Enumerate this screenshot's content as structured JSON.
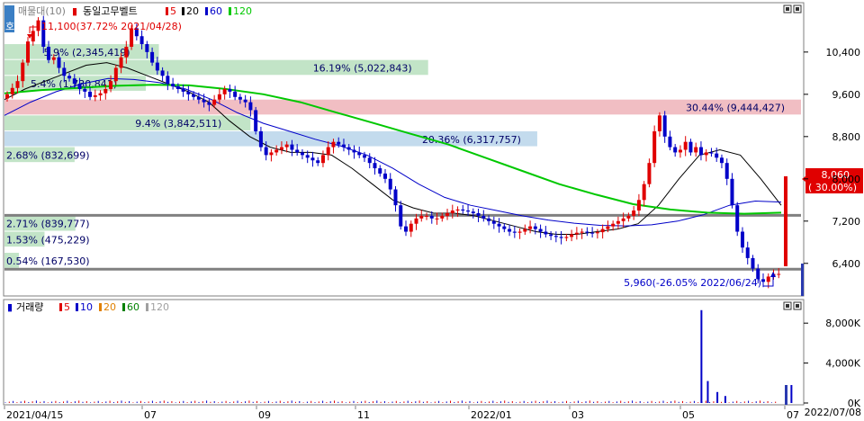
{
  "price_pane": {
    "legend": {
      "marker_label": "호",
      "indicator": "매물대(10)",
      "stock_name": "동일고무벨트",
      "ma_items": [
        {
          "label": "5",
          "color": "#e00000"
        },
        {
          "label": "20",
          "color": "#000000"
        },
        {
          "label": "60",
          "color": "#0000c8"
        },
        {
          "label": "120",
          "color": "#00c800"
        }
      ]
    },
    "y_ticks": [
      "10,400",
      "9,600",
      "8,800",
      "8,000",
      "7,200",
      "6,400"
    ],
    "high_annotation": "11,100(37.72% 2021/04/28)",
    "low_annotation": "5,960(-26.05% 2022/06/24)",
    "current_price": "8,060",
    "current_change": "( 30.00%)"
  },
  "volume_pane": {
    "legend": {
      "title": "거래량",
      "ma_items": [
        {
          "label": "5",
          "color": "#e00000"
        },
        {
          "label": "10",
          "color": "#0000c8"
        },
        {
          "label": "20",
          "color": "#e08000"
        },
        {
          "label": "60",
          "color": "#008000"
        },
        {
          "label": "120",
          "color": "#a0a0a0"
        }
      ]
    },
    "y_ticks": [
      "8,000K",
      "4,000K",
      "0K"
    ]
  },
  "x_axis": {
    "ticks": [
      "2021/04/15",
      "07",
      "09",
      "11",
      "2022/01",
      "03",
      "05",
      "07"
    ],
    "end_date": "2022/07/08"
  },
  "chart_data": {
    "type": "candlestick",
    "ylim": [
      5800,
      11300
    ],
    "volume_ylim": [
      0,
      10000
    ],
    "volume_unit": "K",
    "volume_profile": [
      {
        "price_low": 10250,
        "price_high": 10550,
        "percent": 5.9,
        "volume": 2345419,
        "label": "5.9% (2,345,419)"
      },
      {
        "price_low": 9950,
        "price_high": 10250,
        "percent": 16.19,
        "volume": 5022843,
        "label": "16.19% (5,022,843)"
      },
      {
        "price_low": 9650,
        "price_high": 9950,
        "percent": 5.4,
        "volume": 1730841,
        "label": "5.4% (1,730,841)"
      },
      {
        "price_low": 9200,
        "price_high": 9500,
        "percent": 30.44,
        "volume": 9444427,
        "label": "30.44% (9,444,427)"
      },
      {
        "price_low": 8900,
        "price_high": 9200,
        "percent": 9.4,
        "volume": 3842511,
        "label": "9.4% (3,842,511)"
      },
      {
        "price_low": 8600,
        "price_high": 8900,
        "percent": 20.36,
        "volume": 6317757,
        "label": "20.36% (6,317,757)"
      },
      {
        "price_low": 8300,
        "price_high": 8600,
        "percent": 2.68,
        "volume": 832699,
        "label": "2.68% (832,699)"
      },
      {
        "price_low": 7000,
        "price_high": 7300,
        "percent": 2.71,
        "volume": 839777,
        "label": "2.71% (839,777)"
      },
      {
        "price_low": 6700,
        "price_high": 7000,
        "percent": 1.53,
        "volume": 475229,
        "label": "1.53% (475,229)"
      },
      {
        "price_low": 6300,
        "price_high": 6600,
        "percent": 0.54,
        "volume": 167530,
        "label": "0.54% (167,530)"
      }
    ],
    "horizontal_lines": [
      7310,
      6290
    ],
    "closes": [
      9600,
      9720,
      9850,
      10200,
      10600,
      10800,
      11000,
      10500,
      10250,
      10300,
      10100,
      9950,
      9900,
      9800,
      9700,
      9650,
      9550,
      9580,
      9620,
      9700,
      9850,
      10100,
      10300,
      10500,
      10850,
      10700,
      10550,
      10400,
      10200,
      10050,
      9950,
      9800,
      9750,
      9700,
      9650,
      9600,
      9550,
      9500,
      9450,
      9400,
      9500,
      9600,
      9700,
      9650,
      9550,
      9500,
      9450,
      9300,
      8900,
      8600,
      8450,
      8500,
      8550,
      8600,
      8650,
      8550,
      8500,
      8450,
      8400,
      8350,
      8300,
      8450,
      8600,
      8700,
      8650,
      8600,
      8550,
      8500,
      8450,
      8400,
      8300,
      8200,
      8100,
      8000,
      7800,
      7500,
      7100,
      7000,
      7150,
      7250,
      7300,
      7300,
      7250,
      7250,
      7300,
      7350,
      7400,
      7420,
      7400,
      7380,
      7350,
      7300,
      7250,
      7200,
      7150,
      7100,
      7050,
      7000,
      6980,
      7000,
      7050,
      7100,
      7050,
      7000,
      6950,
      6920,
      6900,
      6880,
      6900,
      6950,
      6980,
      7000,
      6980,
      6970,
      6990,
      7050,
      7100,
      7150,
      7200,
      7250,
      7300,
      7400,
      7600,
      7900,
      8300,
      8900,
      9200,
      8800,
      8600,
      8500,
      8550,
      8700,
      8500,
      8600,
      8450,
      8500,
      8480,
      8400,
      8300,
      8000,
      7500,
      7000,
      6700,
      6500,
      6300,
      6100,
      6050,
      6150,
      6200,
      6200,
      8060
    ],
    "ma_lines": [
      {
        "name": "20",
        "values": [
          9500,
          9700,
          9850,
          10000,
          10150,
          10200,
          10100,
          9950,
          9800,
          9650,
          9450,
          9100,
          8800,
          8600,
          8500,
          8500,
          8450,
          8200,
          7900,
          7600,
          7450,
          7350,
          7350,
          7300,
          7200,
          7100,
          7000,
          6950,
          6950,
          7000,
          7050,
          7150,
          7500,
          8000,
          8450,
          8550,
          8450,
          8000,
          7500
        ]
      },
      {
        "name": "60",
        "values": [
          9200,
          9450,
          9650,
          9800,
          9900,
          9880,
          9820,
          9700,
          9500,
          9250,
          9050,
          8900,
          8750,
          8620,
          8450,
          8200,
          7900,
          7650,
          7500,
          7400,
          7300,
          7220,
          7160,
          7120,
          7110,
          7130,
          7200,
          7320,
          7500,
          7580,
          7560
        ]
      },
      {
        "name": "120",
        "values": [
          9620,
          9680,
          9720,
          9760,
          9780,
          9770,
          9700,
          9600,
          9450,
          9250,
          9050,
          8850,
          8650,
          8400,
          8150,
          7900,
          7700,
          7520,
          7420,
          7360,
          7340,
          7360
        ]
      }
    ],
    "volume_spikes": [
      {
        "position": 0.875,
        "value": 9300
      },
      {
        "position": 0.883,
        "value": 2200
      },
      {
        "position": 0.895,
        "value": 1100
      },
      {
        "position": 0.905,
        "value": 700
      },
      {
        "position": 0.988,
        "value": 1800
      }
    ]
  }
}
